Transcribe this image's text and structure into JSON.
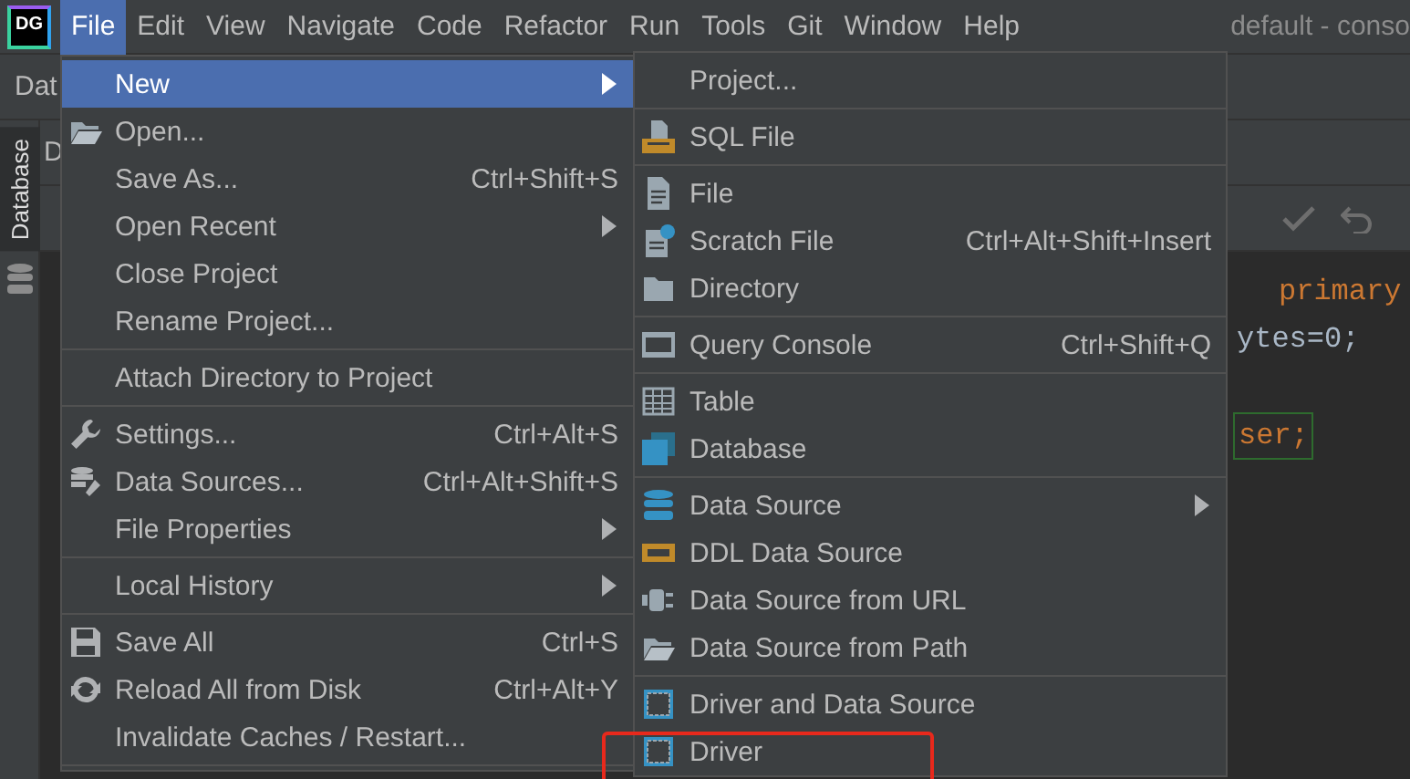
{
  "logo": "DG",
  "menubar": [
    {
      "label": "File",
      "selected": true
    },
    {
      "label": "Edit",
      "selected": false
    },
    {
      "label": "View",
      "selected": false
    },
    {
      "label": "Navigate",
      "selected": false
    },
    {
      "label": "Code",
      "selected": false
    },
    {
      "label": "Refactor",
      "selected": false
    },
    {
      "label": "Run",
      "selected": false
    },
    {
      "label": "Tools",
      "selected": false
    },
    {
      "label": "Git",
      "selected": false
    },
    {
      "label": "Window",
      "selected": false
    },
    {
      "label": "Help",
      "selected": false
    }
  ],
  "window_title": "default - conso",
  "toolbar_label": "Dat",
  "panel_label": "D",
  "side_tab": "Database",
  "code_lines": [
    {
      "kind": "keyword",
      "text": "primary"
    },
    {
      "kind": "plain",
      "text": "ytes=0;"
    },
    {
      "kind": "boxed",
      "text": "ser;"
    }
  ],
  "file_menu": [
    {
      "kind": "plain",
      "label": "New",
      "submenu": true,
      "selected": true
    },
    {
      "kind": "folder-open",
      "label": "Open...",
      "selected": false
    },
    {
      "kind": "plain",
      "label": "Save As...",
      "shortcut": "Ctrl+Shift+S",
      "selected": false
    },
    {
      "kind": "plain",
      "label": "Open Recent",
      "submenu": true,
      "selected": false
    },
    {
      "kind": "plain",
      "label": "Close Project",
      "selected": false
    },
    {
      "kind": "plain",
      "label": "Rename Project...",
      "selected": false
    },
    {
      "kind": "separator"
    },
    {
      "kind": "plain",
      "label": "Attach Directory to Project",
      "selected": false
    },
    {
      "kind": "separator"
    },
    {
      "kind": "wrench",
      "label": "Settings...",
      "shortcut": "Ctrl+Alt+S",
      "selected": false
    },
    {
      "kind": "data-sources",
      "label": "Data Sources...",
      "shortcut": "Ctrl+Alt+Shift+S",
      "selected": false
    },
    {
      "kind": "plain",
      "label": "File Properties",
      "submenu": true,
      "selected": false
    },
    {
      "kind": "separator"
    },
    {
      "kind": "plain",
      "label": "Local History",
      "submenu": true,
      "selected": false
    },
    {
      "kind": "separator"
    },
    {
      "kind": "save",
      "label": "Save All",
      "shortcut": "Ctrl+S",
      "selected": false
    },
    {
      "kind": "reload",
      "label": "Reload All from Disk",
      "shortcut": "Ctrl+Alt+Y",
      "selected": false
    },
    {
      "kind": "plain",
      "label": "Invalidate Caches / Restart...",
      "selected": false
    },
    {
      "kind": "separator"
    }
  ],
  "new_menu": [
    {
      "kind": "plain",
      "label": "Project..."
    },
    {
      "kind": "separator"
    },
    {
      "kind": "sql-file",
      "label": "SQL File"
    },
    {
      "kind": "separator"
    },
    {
      "kind": "file",
      "label": "File"
    },
    {
      "kind": "scratch-file",
      "label": "Scratch File",
      "shortcut": "Ctrl+Alt+Shift+Insert"
    },
    {
      "kind": "folder",
      "label": "Directory"
    },
    {
      "kind": "separator"
    },
    {
      "kind": "console",
      "label": "Query Console",
      "shortcut": "Ctrl+Shift+Q"
    },
    {
      "kind": "separator"
    },
    {
      "kind": "table",
      "label": "Table"
    },
    {
      "kind": "stack",
      "label": "Database"
    },
    {
      "kind": "separator"
    },
    {
      "kind": "cylinder",
      "label": "Data Source",
      "submenu": true
    },
    {
      "kind": "ddl",
      "label": "DDL Data Source"
    },
    {
      "kind": "plug",
      "label": "Data Source from URL"
    },
    {
      "kind": "folder-open",
      "label": "Data Source from Path"
    },
    {
      "kind": "separator"
    },
    {
      "kind": "driver",
      "label": "Driver and Data Source"
    },
    {
      "kind": "driver",
      "label": "Driver",
      "highlight": true
    }
  ]
}
